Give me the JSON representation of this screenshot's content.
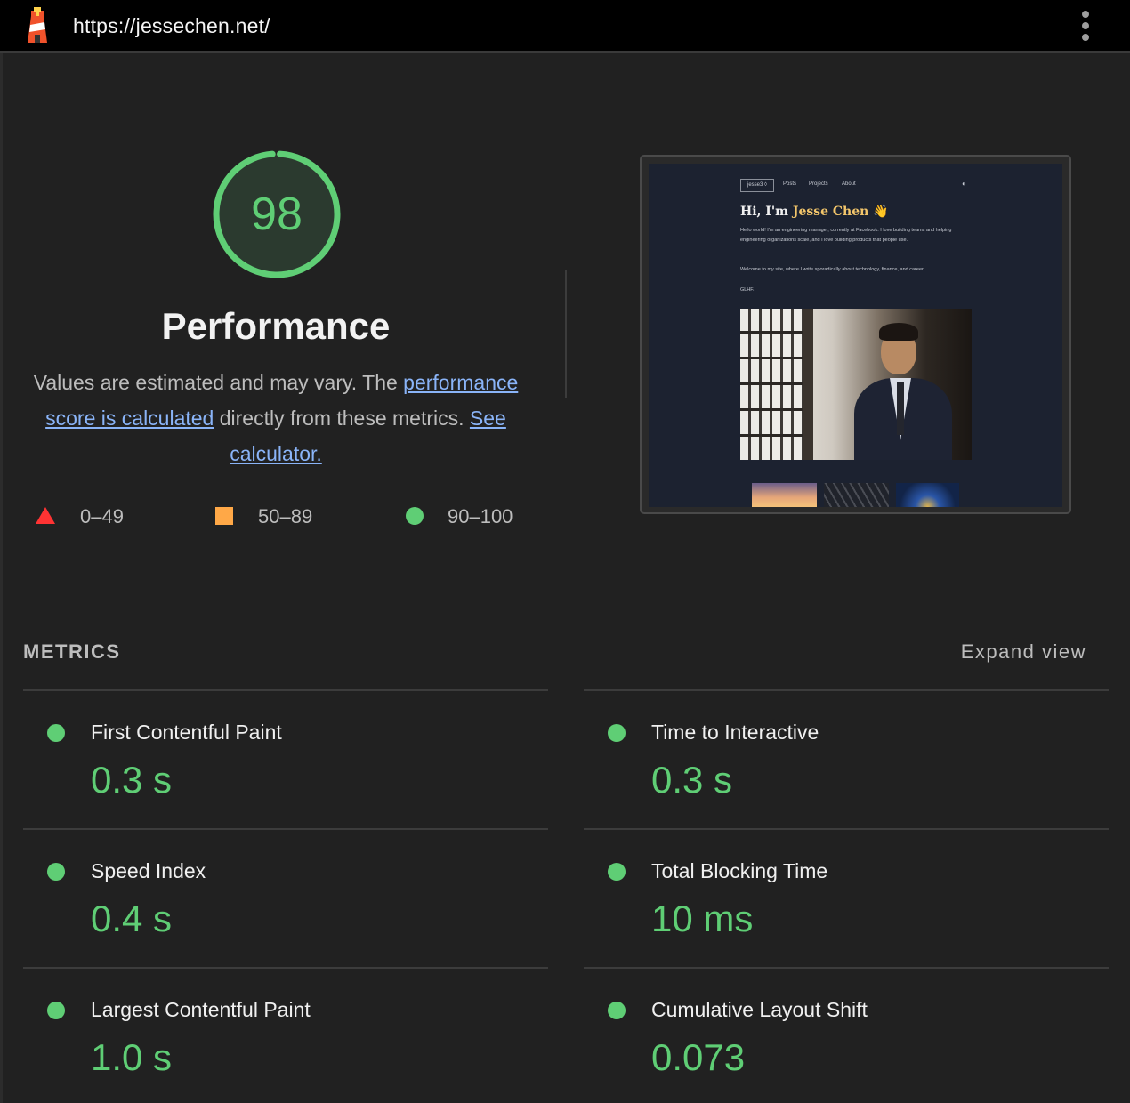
{
  "browser": {
    "url": "https://jessechen.net/",
    "logo_icon": "lighthouse-icon",
    "menu_icon": "vertical-ellipsis-icon"
  },
  "category": {
    "score": "98",
    "score_value": 98,
    "title": "Performance",
    "description_prefix": "Values are estimated and may vary. The ",
    "link_calc": "performance score is calculated",
    "description_middle": " directly from these metrics. ",
    "link_calculator": "See calculator."
  },
  "legend": [
    {
      "range": "0–49",
      "shape": "triangle",
      "color": "#ff3333"
    },
    {
      "range": "50–89",
      "shape": "square",
      "color": "#ffa847"
    },
    {
      "range": "90–100",
      "shape": "circle",
      "color": "#5fce75"
    }
  ],
  "screenshot": {
    "logo": "jesse3 ◊",
    "nav": [
      "Posts",
      "Projects",
      "About"
    ],
    "theme_icon": "theme-toggle-icon",
    "greeting_prefix": "Hi, I'm ",
    "greeting_name": "Jesse Chen",
    "greeting_emoji": "👋",
    "para1": "Hello world! I'm an engineering manager, currently at Facebook. I love building teams and helping engineering organizations scale, and I love building products that people use.",
    "para2": "Welcome to my site, where I write sporadically about technology, finance, and career.",
    "para3": "GLHF."
  },
  "metrics": {
    "header": "METRICS",
    "expand": "Expand view",
    "items": [
      {
        "label": "First Contentful Paint",
        "value": "0.3 s"
      },
      {
        "label": "Time to Interactive",
        "value": "0.3 s"
      },
      {
        "label": "Speed Index",
        "value": "0.4 s"
      },
      {
        "label": "Total Blocking Time",
        "value": "10 ms"
      },
      {
        "label": "Largest Contentful Paint",
        "value": "1.0 s"
      },
      {
        "label": "Cumulative Layout Shift",
        "value": "0.073"
      }
    ]
  },
  "colors": {
    "pass": "#5fce75",
    "link": "#8ab4f8",
    "background": "#212121",
    "topbar": "#000000"
  }
}
